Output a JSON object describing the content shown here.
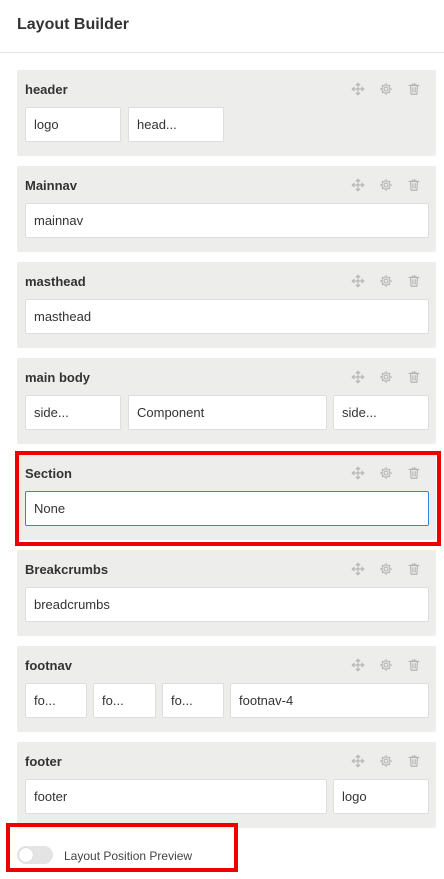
{
  "panel": {
    "title": "Layout Builder"
  },
  "icons": {
    "move": "move-icon",
    "settings": "gear-icon",
    "delete": "trash-icon"
  },
  "colors": {
    "section_bg": "#ededeb",
    "selected_border": "#2e8ad8",
    "highlight": "#ee0000"
  },
  "sections": [
    {
      "title": "header",
      "columns": [
        "logo",
        "head..."
      ]
    },
    {
      "title": "Mainnav",
      "columns": [
        "mainnav"
      ]
    },
    {
      "title": "masthead",
      "columns": [
        "masthead"
      ]
    },
    {
      "title": "main body",
      "columns": [
        "side...",
        "Component",
        "side..."
      ]
    },
    {
      "title": "Section",
      "columns": [
        "None"
      ]
    },
    {
      "title": "Breakcrumbs",
      "columns": [
        "breadcrumbs"
      ]
    },
    {
      "title": "footnav",
      "columns": [
        "fo...",
        "fo...",
        "fo...",
        "footnav-4"
      ]
    },
    {
      "title": "footer",
      "columns": [
        "footer",
        "logo"
      ]
    }
  ],
  "preview_toggle": {
    "label": "Layout Position Preview",
    "enabled": false
  }
}
